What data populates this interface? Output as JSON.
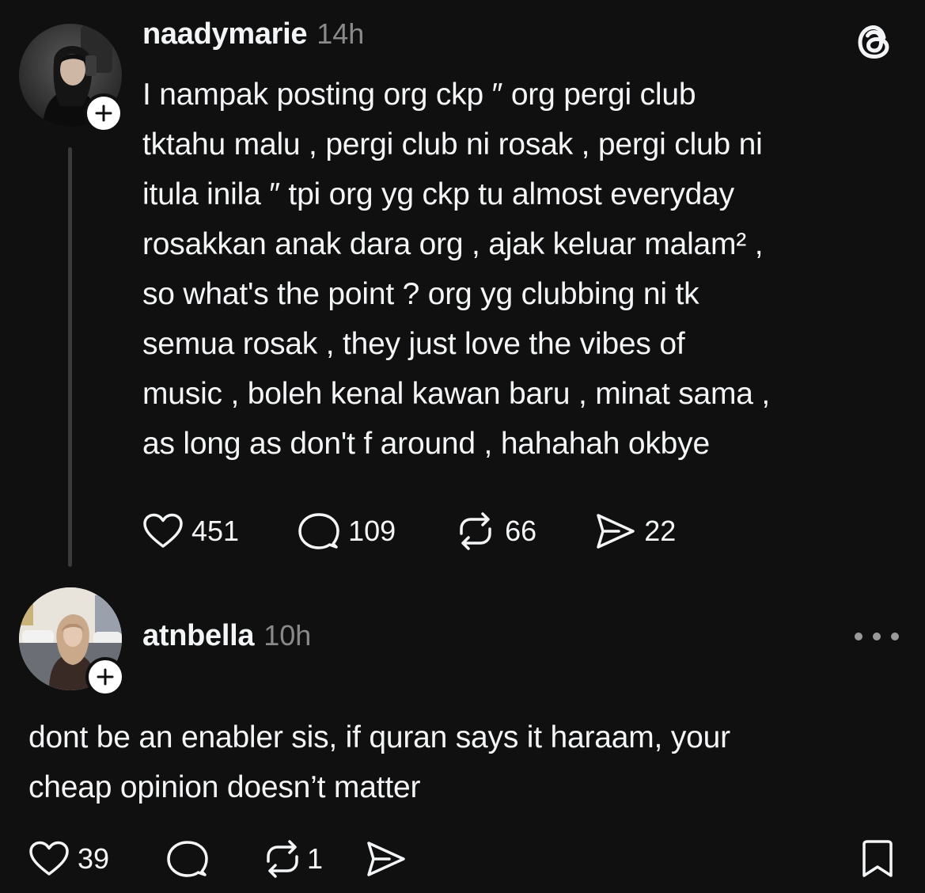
{
  "app": {
    "accent_color": "#f3f5f7",
    "background_color": "#101010",
    "muted_color": "#8a8a8a",
    "logo_icon": "threads-logo-icon"
  },
  "post": {
    "username": "naadymarie",
    "time": "14h",
    "text": "I nampak posting org ckp ″ org pergi club\ntktahu malu , pergi club ni rosak , pergi club ni\nitula inila ″ tpi org yg ckp tu almost everyday\nrosakkan anak dara org , ajak keluar malam² ,\nso what's the point ? org yg clubbing ni tk\nsemua rosak , they just love the vibes of\nmusic , boleh kenal kawan baru , minat sama ,\nas long as don't f around , hahahah okbye",
    "likes": "451",
    "replies": "109",
    "reposts": "66",
    "shares": "22"
  },
  "reply": {
    "username": "atnbella",
    "time": "10h",
    "text": "dont be an enabler sis, if quran says it haraam, your\ncheap opinion doesn’t matter",
    "likes": "39",
    "reposts": "1",
    "more_icon": "more-dots-icon",
    "bookmark_icon": "bookmark-icon"
  }
}
